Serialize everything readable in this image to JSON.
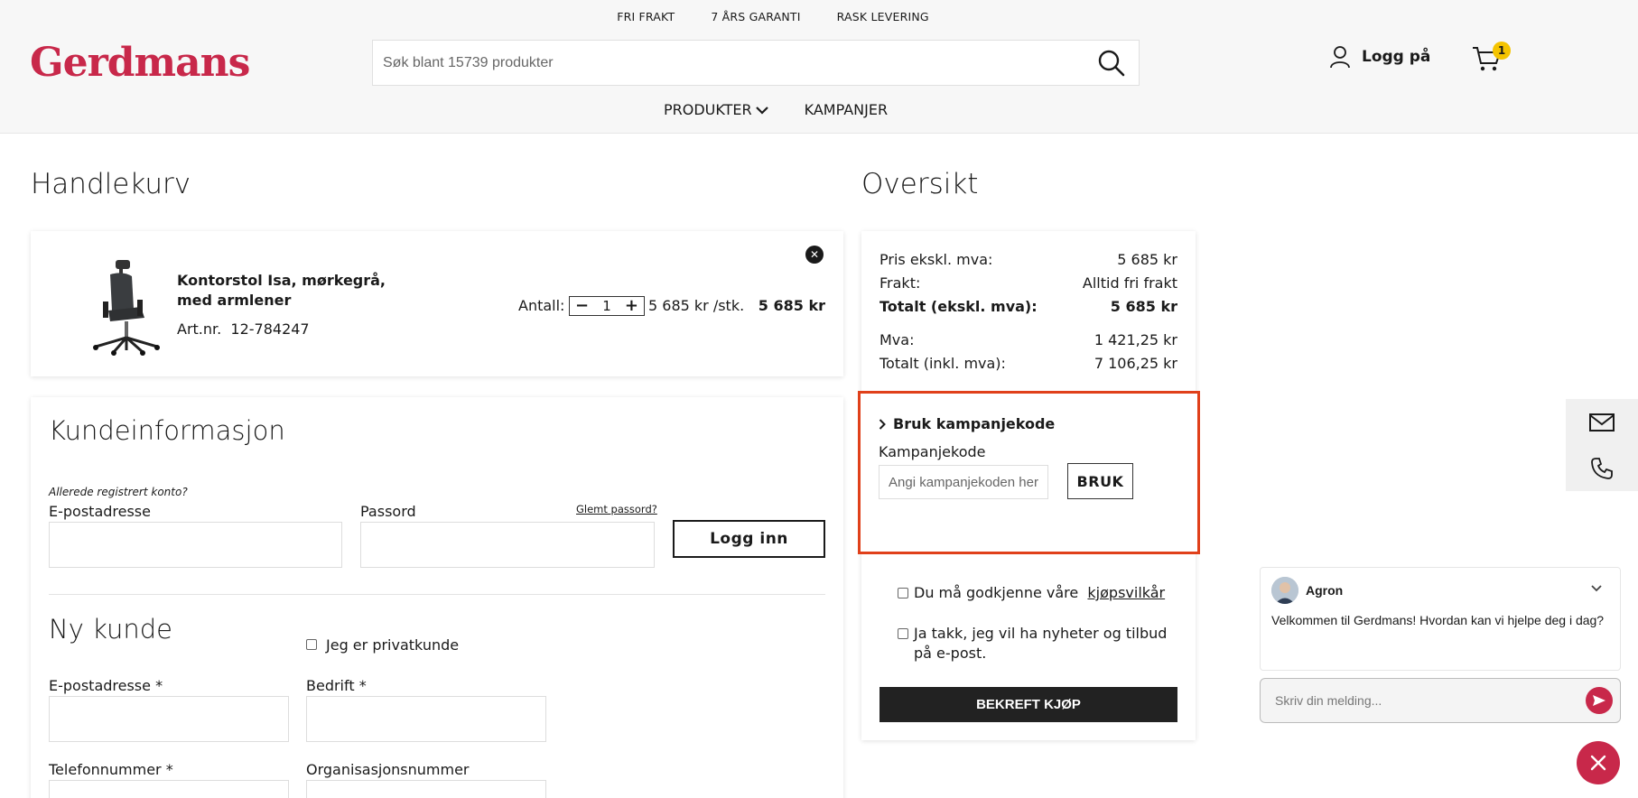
{
  "header": {
    "usps": [
      "FRI FRAKT",
      "7 ÅRS GARANTI",
      "RASK LEVERING"
    ],
    "logo": "Gerdmans",
    "search_placeholder": "Søk blant 15739 produkter",
    "login_label": "Logg på",
    "cart_count": "1",
    "nav": {
      "products": "PRODUKTER",
      "campaigns": "KAMPANJER"
    }
  },
  "cart": {
    "title": "Handlekurv",
    "item": {
      "name": "Kontorstol Isa, mørkegrå, med armlener",
      "art_label": "Art.nr.",
      "art_number": "12-784247",
      "qty_label": "Antall:",
      "qty": "1",
      "qty_minus": "−",
      "qty_plus": "+",
      "unit_price": "5 685 kr /stk.",
      "total": "5 685 kr"
    }
  },
  "customer": {
    "title": "Kundeinformasjon",
    "registered_hint": "Allerede registrert konto?",
    "email_label": "E-postadresse",
    "password_label": "Passord",
    "forgot_password": "Glemt passord?",
    "login_button": "Logg inn",
    "new_customer_title": "Ny kunde",
    "private_label": "Jeg er privatkunde",
    "new_email_label": "E-postadresse *",
    "company_label": "Bedrift *",
    "phone_label": "Telefonnummer *",
    "org_label": "Organisasjonsnummer"
  },
  "summary": {
    "title": "Oversikt",
    "rows": [
      {
        "label": "Pris ekskl. mva:",
        "value": "5 685 kr"
      },
      {
        "label": "Frakt:",
        "value": "Alltid fri frakt"
      },
      {
        "label": "Totalt (ekskl. mva):",
        "value": "5 685 kr"
      },
      {
        "label": "Mva:",
        "value": "1 421,25 kr"
      },
      {
        "label": "Totalt (inkl. mva):",
        "value": "7 106,25 kr"
      }
    ],
    "campaign": {
      "heading": "Bruk kampanjekode",
      "label": "Kampanjekode",
      "placeholder": "Angi kampanjekoden her",
      "button": "BRUK"
    },
    "terms_text": "Du må godkjenne våre",
    "terms_link": "kjøpsvilkår",
    "newsletter_text": "Ja takk, jeg vil ha nyheter og tilbud på e-post.",
    "confirm_button": "BEKREFT KJØP"
  },
  "chat": {
    "agent_name": "Agron",
    "message": "Velkommen til Gerdmans! Hvordan kan vi hjelpe deg i dag?",
    "input_placeholder": "Skriv din melding..."
  },
  "colors": {
    "brand": "#c8284a",
    "highlight": "#e0401a",
    "badge": "#f5c400"
  }
}
